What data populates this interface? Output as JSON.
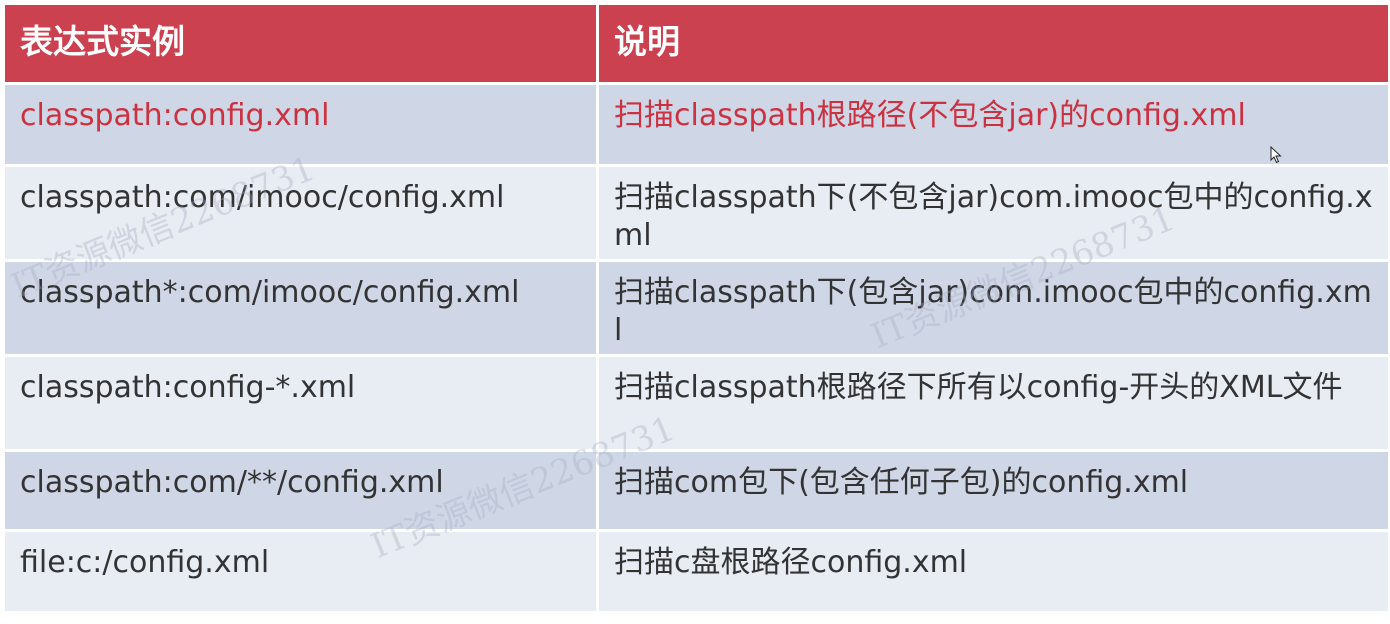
{
  "table": {
    "headers": {
      "expression": "表达式实例",
      "description": "说明"
    },
    "rows": [
      {
        "expression": "classpath:config.xml",
        "description": "扫描classpath根路径(不包含jar)的config.xml"
      },
      {
        "expression": "classpath:com/imooc/config.xml",
        "description": "扫描classpath下(不包含jar)com.imooc包中的config.xml"
      },
      {
        "expression": "classpath*:com/imooc/config.xml",
        "description": "扫描classpath下(包含jar)com.imooc包中的config.xml"
      },
      {
        "expression": "classpath:config-*.xml",
        "description": "扫描classpath根路径下所有以config-开头的XML文件"
      },
      {
        "expression": "classpath:com/**/config.xml",
        "description": "扫描com包下(包含任何子包)的config.xml"
      },
      {
        "expression": "file:c:/config.xml",
        "description": "扫描c盘根路径config.xml"
      }
    ]
  },
  "watermark": {
    "text_1": "IT资源微信2268731",
    "text_2": "IT资源微信2268731",
    "text_3": "IT资源微信2268731"
  },
  "colors": {
    "header_bg": "#cc4150",
    "row_odd_bg": "#cfd7e7",
    "row_even_bg": "#e8ecf3",
    "highlight_text": "#cc3140"
  },
  "icons": {
    "cursor": "mouse-pointer-icon"
  }
}
